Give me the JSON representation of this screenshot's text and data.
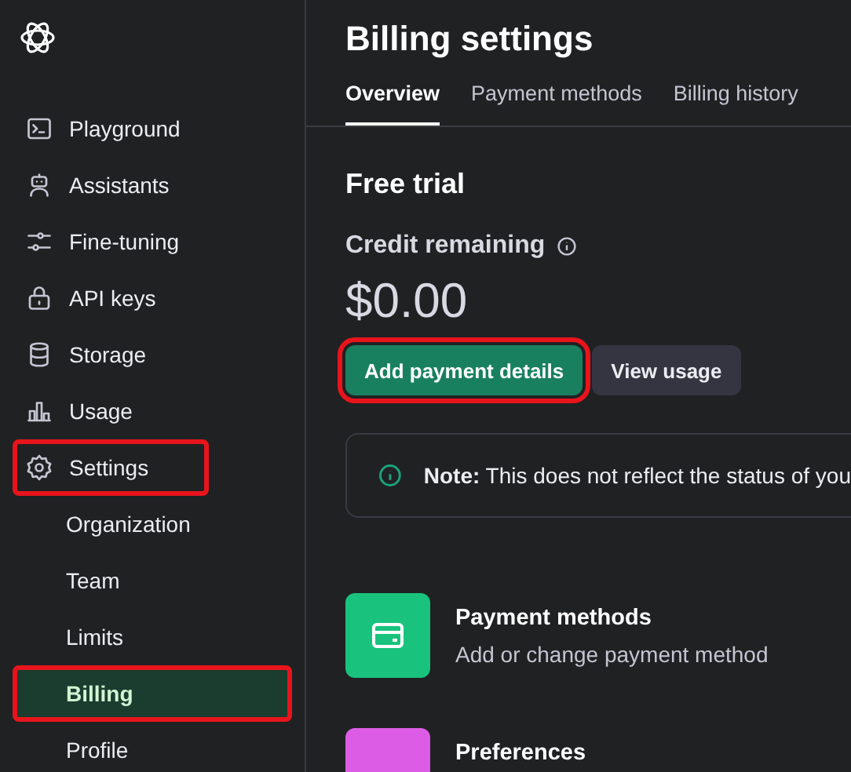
{
  "sidebar": {
    "items": [
      {
        "label": "Playground",
        "kind": "terminal",
        "selected": false,
        "highlighted": false
      },
      {
        "label": "Assistants",
        "kind": "robot",
        "selected": false,
        "highlighted": false
      },
      {
        "label": "Fine-tuning",
        "kind": "sliders",
        "selected": false,
        "highlighted": false
      },
      {
        "label": "API keys",
        "kind": "lock",
        "selected": false,
        "highlighted": false
      },
      {
        "label": "Storage",
        "kind": "database",
        "selected": false,
        "highlighted": false
      },
      {
        "label": "Usage",
        "kind": "chart",
        "selected": false,
        "highlighted": false
      },
      {
        "label": "Settings",
        "kind": "gear",
        "selected": false,
        "highlighted": true,
        "children": [
          {
            "label": "Organization",
            "selected": false,
            "highlighted": false
          },
          {
            "label": "Team",
            "selected": false,
            "highlighted": false
          },
          {
            "label": "Limits",
            "selected": false,
            "highlighted": false
          },
          {
            "label": "Billing",
            "selected": true,
            "highlighted": true
          },
          {
            "label": "Profile",
            "selected": false,
            "highlighted": false
          }
        ]
      }
    ]
  },
  "page": {
    "title": "Billing settings",
    "tabs": [
      {
        "label": "Overview",
        "selected": true
      },
      {
        "label": "Payment methods",
        "selected": false
      },
      {
        "label": "Billing history",
        "selected": false
      }
    ],
    "plan": "Free trial",
    "credit_label": "Credit remaining",
    "credit": "$0.00",
    "buttons": [
      {
        "label": "Add payment details",
        "kind": "primary",
        "highlighted": true
      },
      {
        "label": "View usage",
        "kind": "secondary",
        "highlighted": false
      }
    ],
    "note": "**Note:** This does not reflect the status of you",
    "cards": [
      {
        "title": "Payment methods",
        "description": "Add or change payment method",
        "color": "#19c37d"
      },
      {
        "title": "Preferences",
        "color": "#dd5ce5"
      }
    ]
  }
}
